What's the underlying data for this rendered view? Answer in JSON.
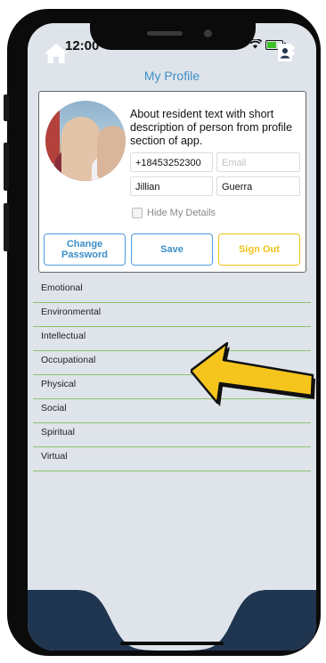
{
  "status_bar": {
    "time": "12:00"
  },
  "header": {
    "title": "My Profile"
  },
  "profile": {
    "about": "About resident text with short description of person from profile section of app.",
    "phone": "+18453252300",
    "email_placeholder": "Email",
    "first_name": "Jillian",
    "last_name": "Guerra",
    "hide_details_label": "Hide My Details",
    "hide_details_checked": false
  },
  "actions": {
    "change_password": "Change Password",
    "save": "Save",
    "sign_out": "Sign Out"
  },
  "categories": [
    "Emotional",
    "Environmental",
    "Intellectual",
    "Occupational",
    "Physical",
    "Social",
    "Spiritual",
    "Virtual"
  ],
  "tab_bar": {
    "left_icon": "home-icon",
    "right_icon": "contact-book-icon"
  },
  "colors": {
    "accent": "#3c8fc7",
    "sign_out": "#f1c21a",
    "divider": "#8bc46a",
    "tab_bar": "#1f3550",
    "arrow": "#f5c51e"
  }
}
